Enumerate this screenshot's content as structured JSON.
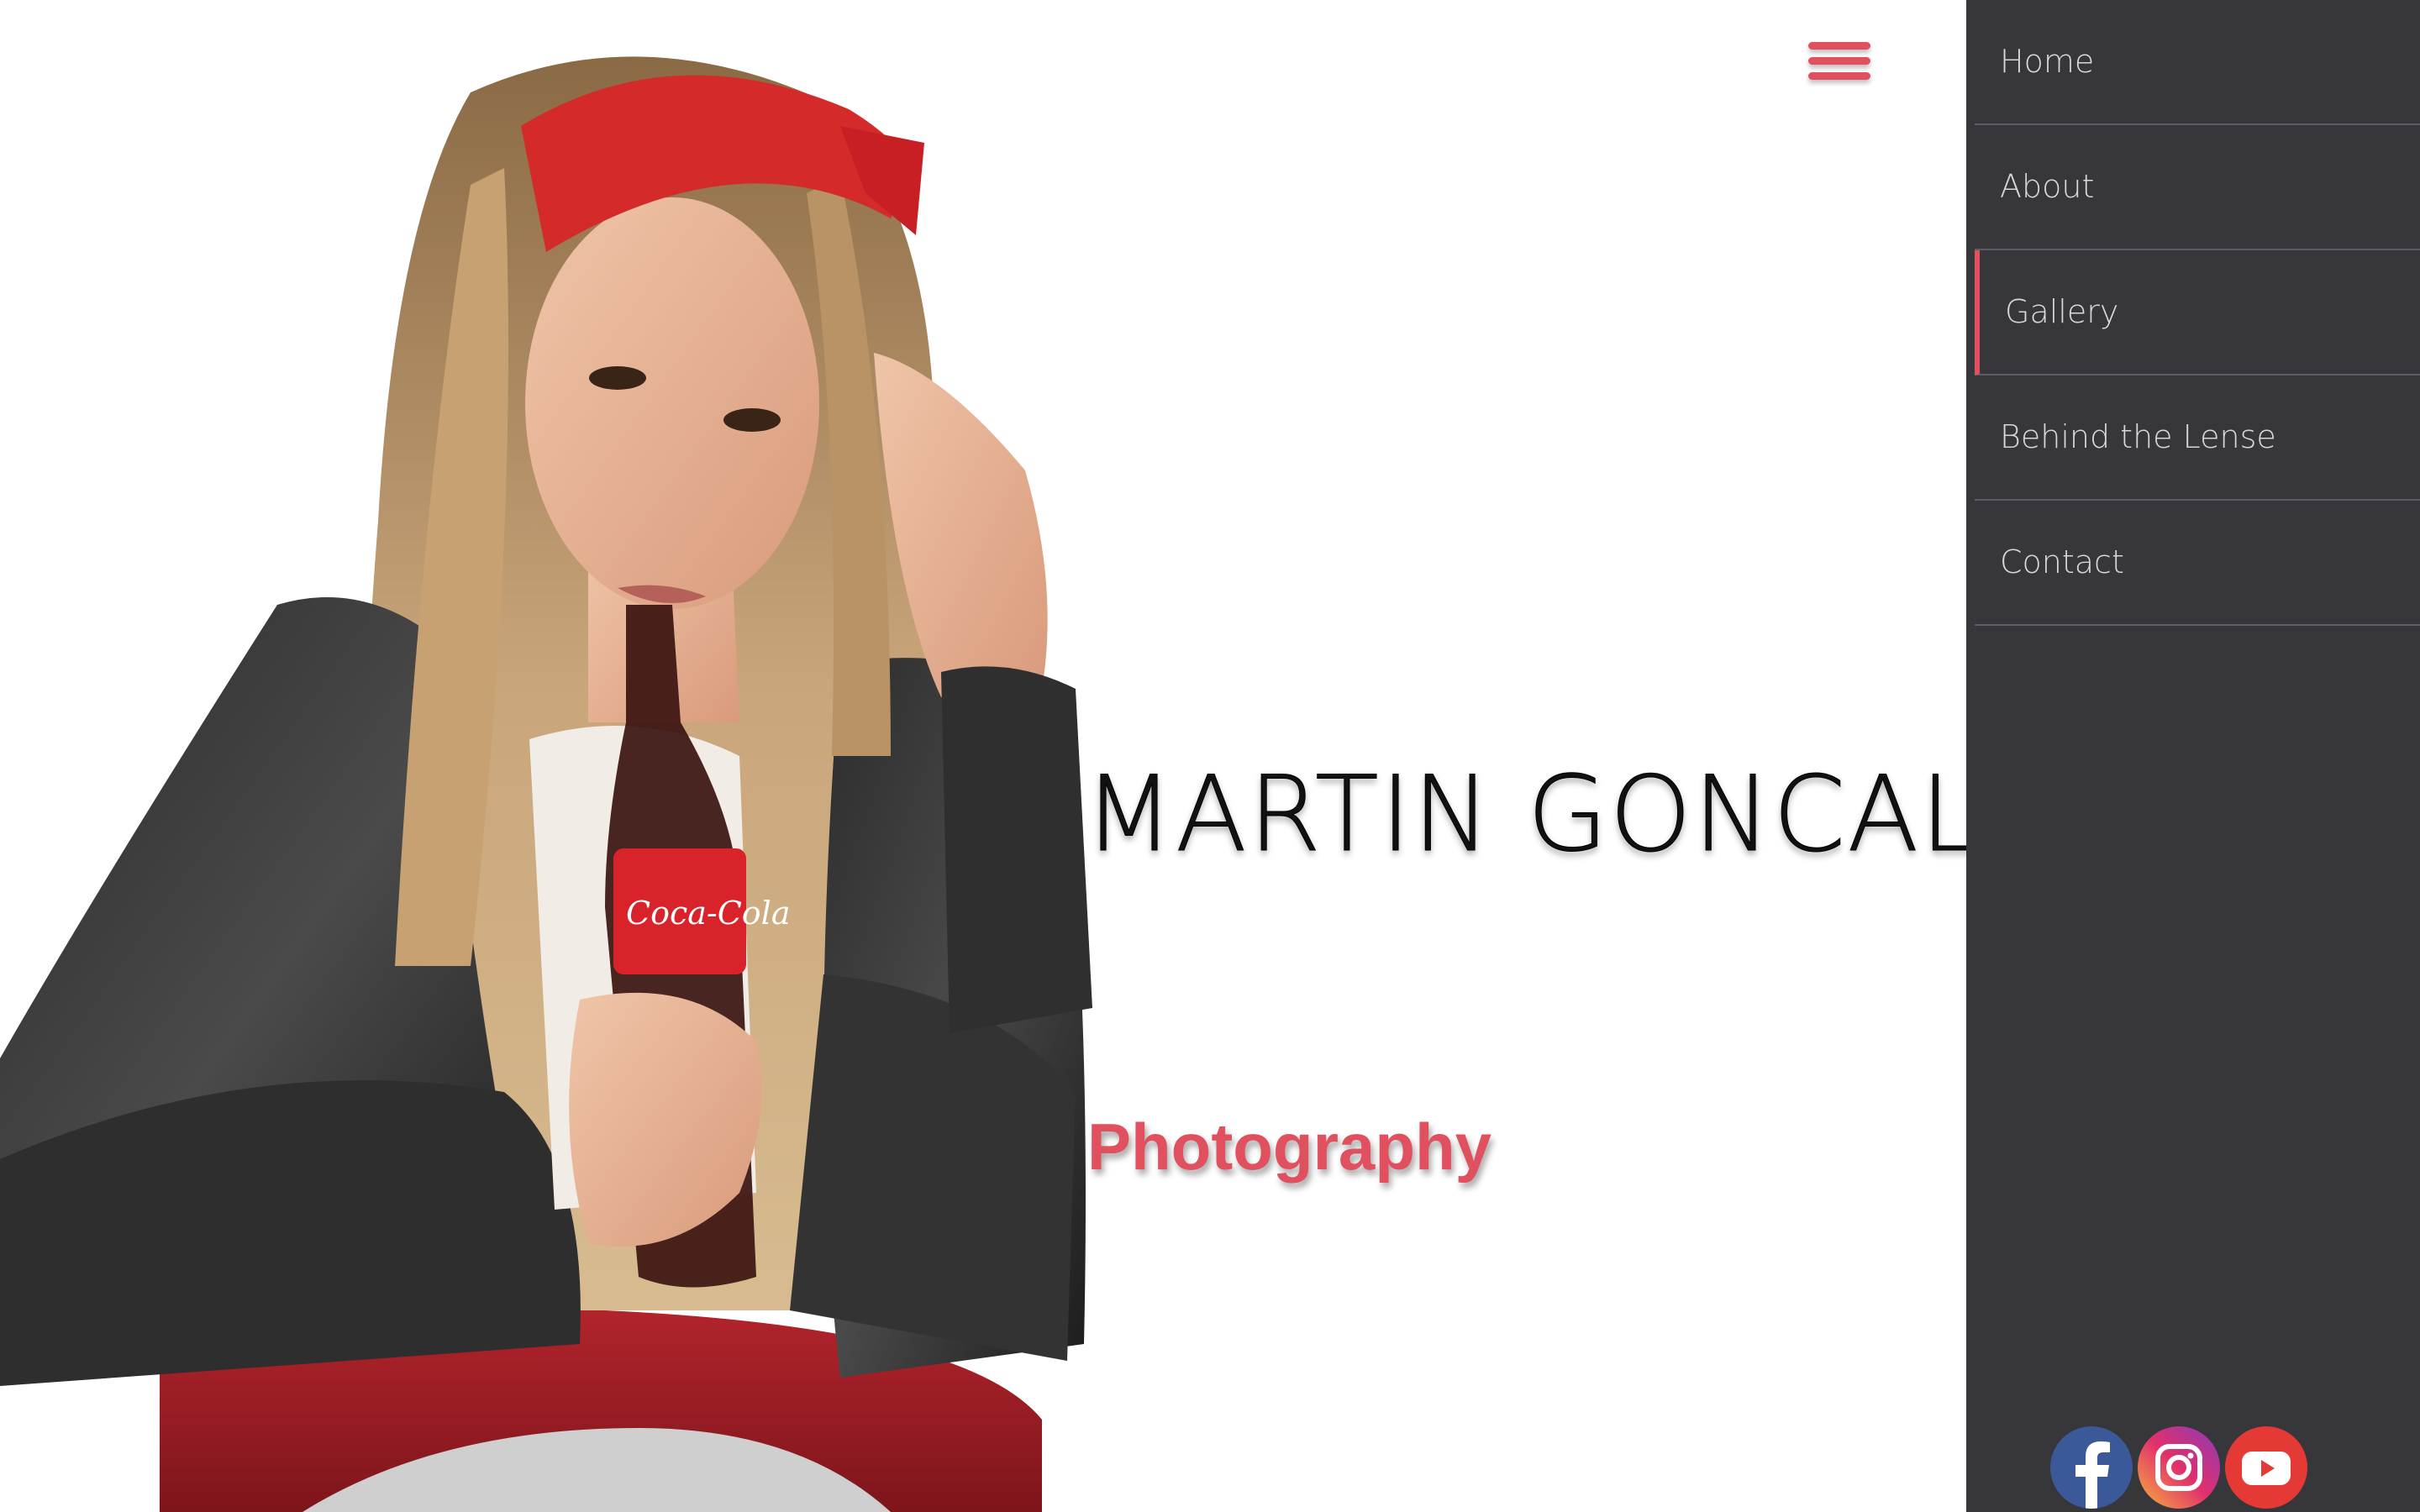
{
  "header": {
    "menu_icon": "hamburger-menu-icon"
  },
  "hero": {
    "title": "MARTIN GONCAL",
    "subtitle": "Photography",
    "photo_icon": "portrait-photo"
  },
  "side_menu": {
    "items": [
      {
        "label": "Home",
        "active": false
      },
      {
        "label": "About",
        "active": false
      },
      {
        "label": "Gallery",
        "active": true
      },
      {
        "label": "Behind the Lense",
        "active": false
      },
      {
        "label": "Contact",
        "active": false
      }
    ],
    "social": [
      {
        "icon": "facebook-icon",
        "color": "#3b5998"
      },
      {
        "icon": "instagram-icon",
        "color": "#e1306c"
      },
      {
        "icon": "youtube-icon",
        "color": "#e53935"
      }
    ]
  },
  "colors": {
    "accent": "#e0505f",
    "sidebar_bg": "#36363b",
    "sidebar_text": "#d8d8dc",
    "page_bg": "#ffffff"
  }
}
